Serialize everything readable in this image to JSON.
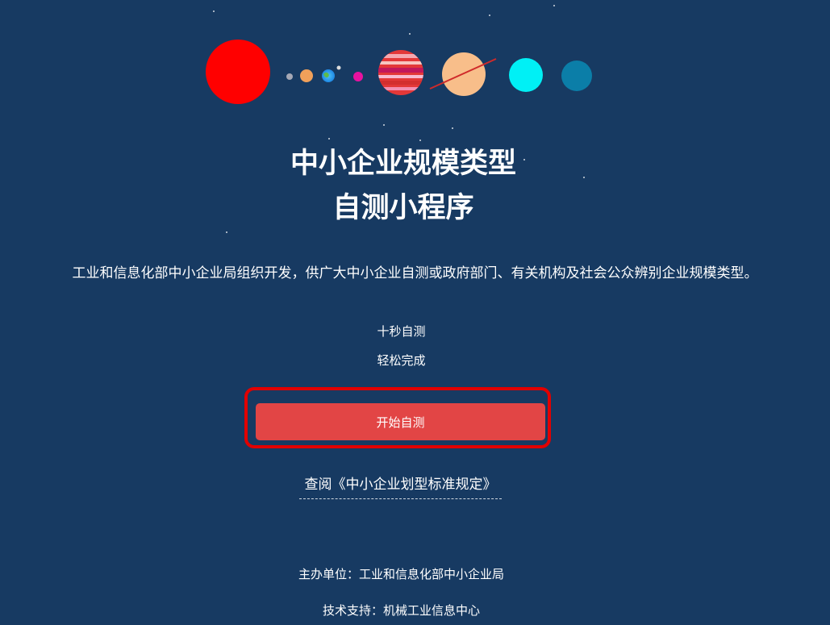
{
  "title": {
    "line1": "中小企业规模类型",
    "line2": "自测小程序"
  },
  "description": "工业和信息化部中小企业局组织开发，供广大中小企业自测或政府部门、有关机构及社会公众辨别企业规模类型。",
  "taglines": {
    "first": "十秒自测",
    "second": "轻松完成"
  },
  "start_button": {
    "label": "开始自测"
  },
  "standard_link": {
    "label": "查阅《中小企业划型标准规定》"
  },
  "footer": {
    "sponsor": "主办单位：工业和信息化部中小企业局",
    "support": "技术支持：机械工业信息中心"
  },
  "colors": {
    "background": "#173a62",
    "button": "#e24545",
    "highlight": "#e20000"
  },
  "planets": [
    "sun-icon",
    "mercury-icon",
    "venus-icon",
    "earth-icon",
    "mars-icon",
    "jupiter-icon",
    "saturn-icon",
    "uranus-icon",
    "neptune-icon"
  ]
}
